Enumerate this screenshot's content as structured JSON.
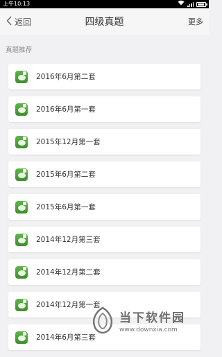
{
  "status_bar": {
    "time": "上午10:13",
    "icons": [
      "wifi-icon",
      "signal-icon",
      "battery-icon"
    ]
  },
  "nav": {
    "back_label": "返回",
    "title": "四级真题",
    "more_label": "更多"
  },
  "section": {
    "header": "真题推荐"
  },
  "items": [
    {
      "label": "2016年6月第二套"
    },
    {
      "label": "2016年6月第一套"
    },
    {
      "label": "2015年12月第一套"
    },
    {
      "label": "2015年6月第二套"
    },
    {
      "label": "2015年6月第一套"
    },
    {
      "label": "2014年12月第三套"
    },
    {
      "label": "2014年12月第二套"
    },
    {
      "label": "2014年12月第一套"
    },
    {
      "label": "2014年6月第三套"
    }
  ],
  "watermark": {
    "title": "当下软件园",
    "url": "www.downxia.com"
  },
  "colors": {
    "icon_green": "#4fa33c",
    "background": "#f1f1f3"
  }
}
